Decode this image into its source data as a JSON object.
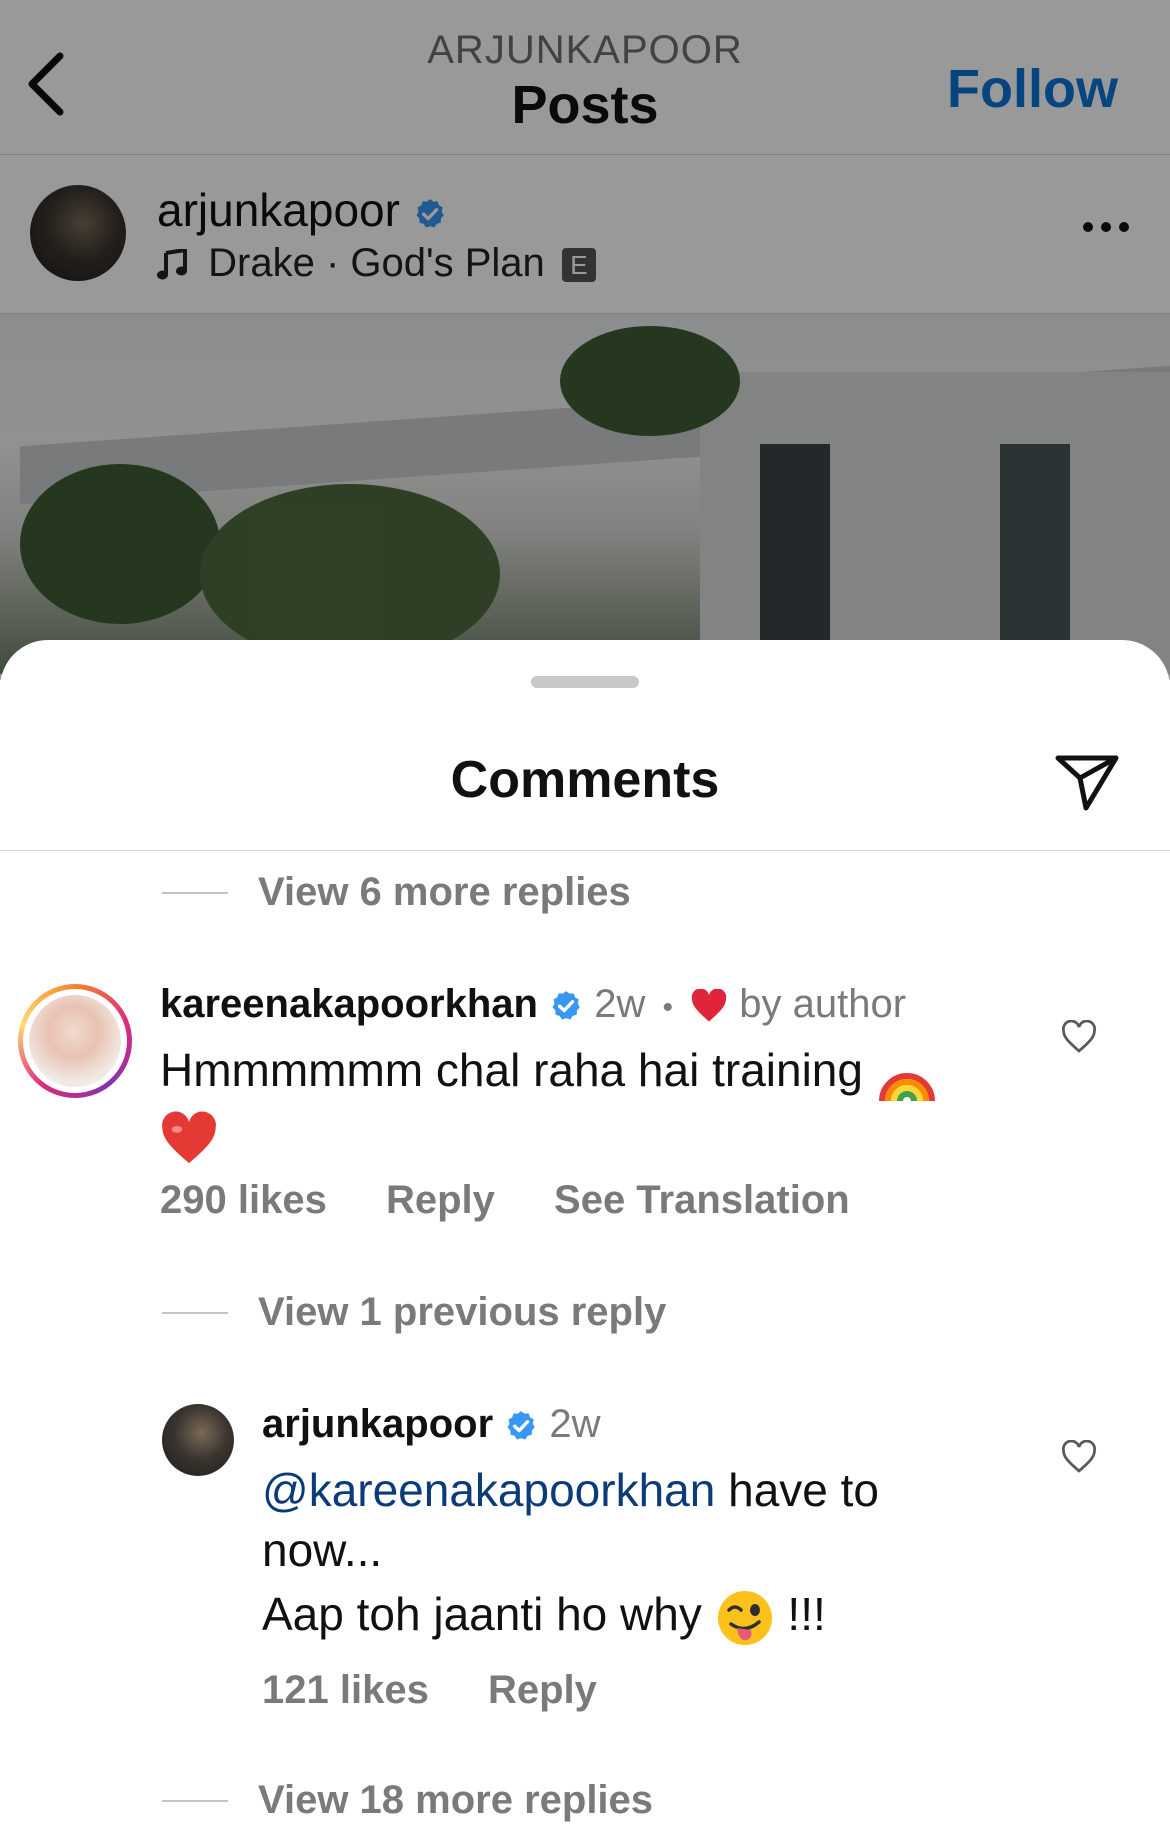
{
  "header": {
    "subtitle": "ARJUNKAPOOR",
    "title": "Posts",
    "follow_label": "Follow"
  },
  "post": {
    "username": "arjunkapoor",
    "song": "Drake · God's Plan",
    "explicit_badge": "E"
  },
  "comments_sheet": {
    "title": "Comments",
    "view_more_top": "View 6 more replies",
    "comment1": {
      "username": "kareenakapoorkhan",
      "time": "2w",
      "separator": "•",
      "liked_by": "by author",
      "text_line1": "Hmmmmmm chal raha hai training",
      "likes": "290 likes",
      "reply": "Reply",
      "see_translation": "See Translation"
    },
    "view_previous": "View 1 previous reply",
    "reply1": {
      "username": "arjunkapoor",
      "time": "2w",
      "mention": "@kareenakapoorkhan",
      "text_after_mention": " have to",
      "text_line2": "now...",
      "text_line3": "Aap toh jaanti ho why",
      "text_suffix": "!!!",
      "likes": "121 likes",
      "reply": "Reply"
    },
    "view_more_bottom": "View 18 more replies"
  },
  "colors": {
    "follow_blue": "#0a74d6",
    "verified_blue": "#3897f0",
    "heart_red": "#e0243a",
    "muted_text": "#7a7a7a"
  },
  "icons": [
    "back-chevron-icon",
    "verified-badge-icon",
    "music-note-icon",
    "more-options-icon",
    "send-icon",
    "heart-outline-icon",
    "heart-filled-icon",
    "rainbow-emoji",
    "red-heart-emoji",
    "winking-tongue-emoji"
  ]
}
